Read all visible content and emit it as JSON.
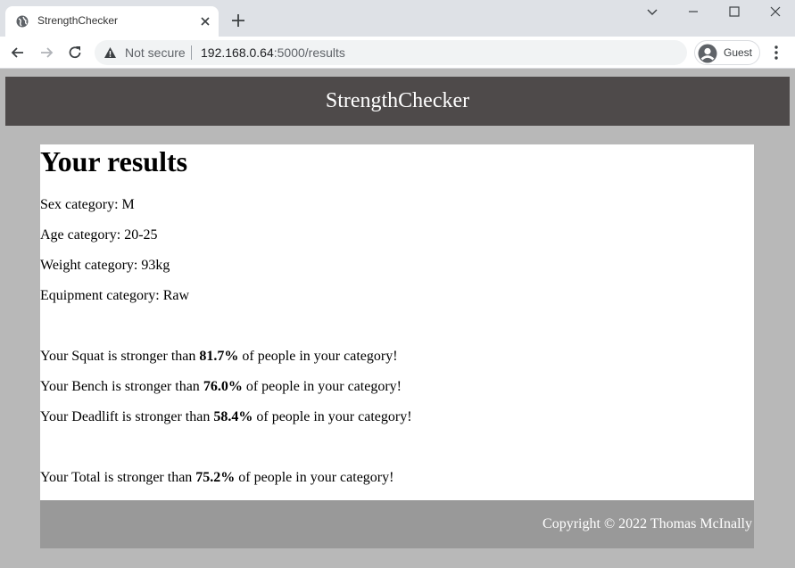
{
  "browser": {
    "tab_title": "StrengthChecker",
    "security_label": "Not secure",
    "url_host": "192.168.0.64",
    "url_path": ":5000/results",
    "profile_label": "Guest"
  },
  "site": {
    "header_title": "StrengthChecker"
  },
  "results": {
    "heading": "Your results",
    "sex_label": "Sex category: ",
    "sex_value": "M",
    "age_label": "Age category: ",
    "age_value": "20-25",
    "weight_label": "Weight category: ",
    "weight_value": "93kg",
    "equipment_label": "Equipment category: ",
    "equipment_value": "Raw",
    "squat_prefix": "Your Squat is stronger than ",
    "squat_pct": "81.7%",
    "bench_prefix": "Your Bench is stronger than ",
    "bench_pct": "76.0%",
    "deadlift_prefix": "Your Deadlift is stronger than ",
    "deadlift_pct": "58.4%",
    "total_prefix": "Your Total is stronger than ",
    "total_pct": "75.2%",
    "suffix": " of people in your category!"
  },
  "footer": {
    "copyright": "Copyright © 2022 Thomas McInally"
  }
}
